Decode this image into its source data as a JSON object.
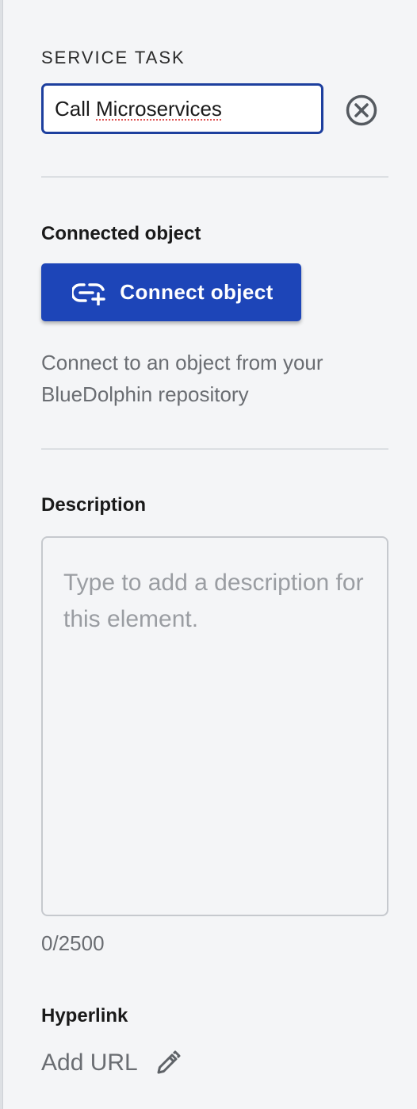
{
  "task": {
    "section_label": "SERVICE TASK",
    "name_value_part1": "Call ",
    "name_value_part2": "Microservices",
    "clear_icon": "close-circle-icon"
  },
  "connected_object": {
    "heading": "Connected object",
    "button_label": "Connect object",
    "button_icon": "link-add-icon",
    "helper_text": "Connect to an object from your BlueDolphin repository",
    "accent_color": "#1d45b8"
  },
  "description": {
    "heading": "Description",
    "placeholder": "Type to add a description for this element.",
    "counter": "0/2500"
  },
  "hyperlink": {
    "heading": "Hyperlink",
    "add_label": "Add URL",
    "edit_icon": "pencil-icon"
  }
}
